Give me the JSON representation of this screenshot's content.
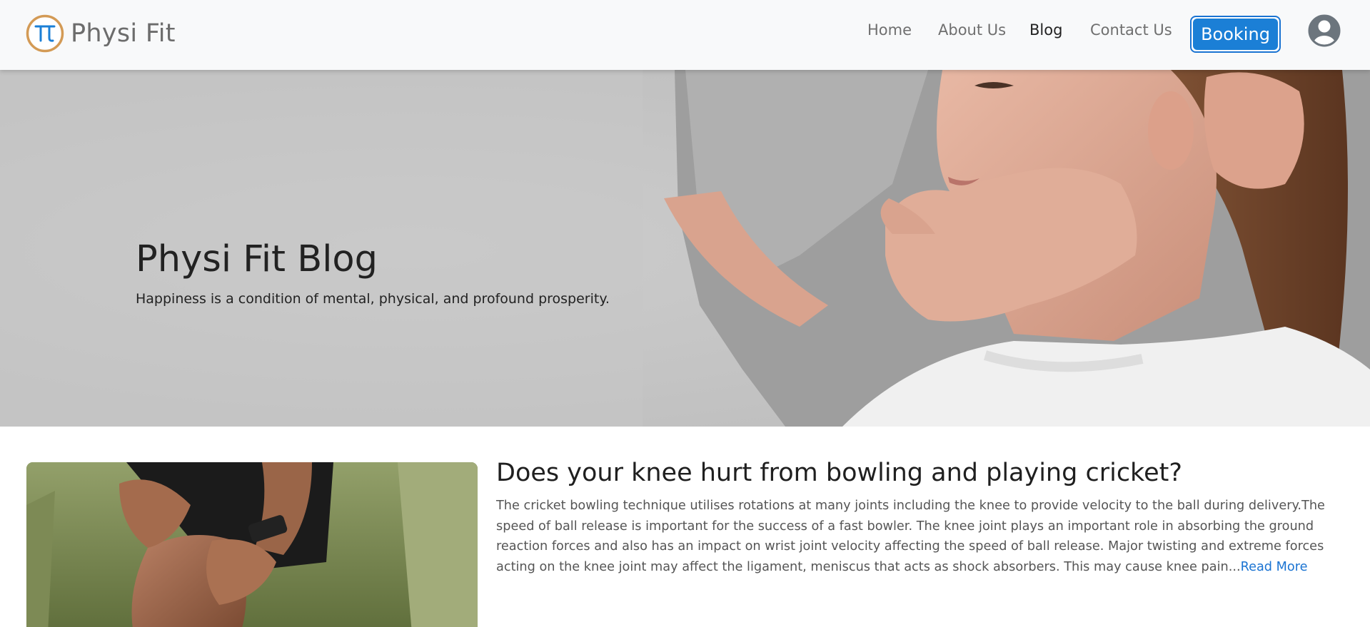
{
  "brand": {
    "name": "Physi Fit",
    "logo_icon": "pi-icon",
    "logo_color": "#d39a55",
    "logo_glyph_color": "#1b7fd6"
  },
  "nav": {
    "items": [
      {
        "label": "Home"
      },
      {
        "label": "About Us"
      },
      {
        "label": "Blog"
      },
      {
        "label": "Contact Us"
      }
    ],
    "booking_label": "Booking",
    "account_icon": "user-circle-icon"
  },
  "hero": {
    "title": "Physi Fit Blog",
    "subtitle": "Happiness is a condition of mental, physical, and profound prosperity."
  },
  "post": {
    "title": "Does your knee hurt from bowling and playing cricket?",
    "excerpt": "The cricket bowling technique utilises rotations at many joints including the knee to provide velocity to the ball during delivery.The speed of ball release is important for the success of a fast bowler. The knee joint plays an important role in absorbing the ground reaction forces and also has an impact on wrist joint velocity affecting the speed of ball release. Major twisting and extreme forces acting on the knee joint may affect the ligament, meniscus that acts as shock absorbers. This may cause knee pain...",
    "read_more": "Read More"
  },
  "colors": {
    "accent": "#1b7fd6",
    "navbar_bg": "#f8f9fa",
    "text_dark": "#222222",
    "text_muted": "#6f6f6f"
  }
}
